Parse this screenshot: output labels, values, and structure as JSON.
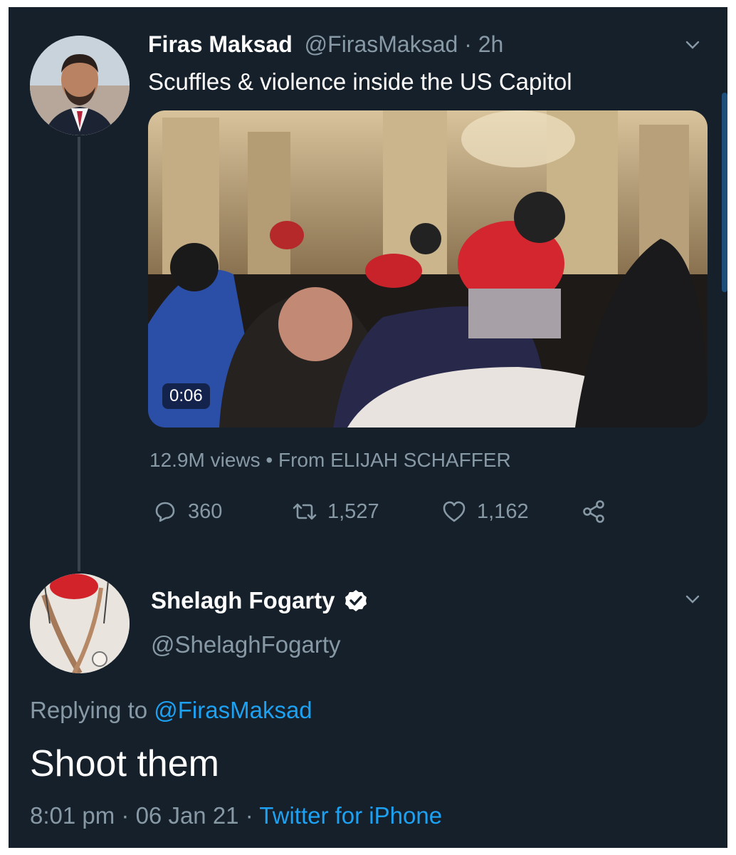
{
  "colors": {
    "background": "#15202b",
    "text_primary": "#ffffff",
    "text_secondary": "#8899a6",
    "link": "#1da1f2",
    "divider": "#38444d"
  },
  "tweet": {
    "author_name": "Firas Maksad",
    "author_handle": "@FirasMaksad",
    "separator": " · ",
    "time": "2h",
    "text": "Scuffles & violence inside the US Capitol",
    "video": {
      "duration": "0:06"
    },
    "views": "12.9M views",
    "views_separator": " • ",
    "source": "From ELIJAH SCHAFFER",
    "actions": {
      "replies": "360",
      "retweets": "1,527",
      "likes": "1,162",
      "reply_icon": "reply-icon",
      "retweet_icon": "retweet-icon",
      "like_icon": "heart-icon",
      "share_icon": "share-icon"
    }
  },
  "reply": {
    "author_name": "Shelagh Fogarty",
    "author_handle": "@ShelaghFogarty",
    "verified_icon": "verified-badge-icon",
    "replying_prefix": "Replying to ",
    "replying_to": "@FirasMaksad",
    "text": "Shoot them",
    "time": "8:01 pm",
    "date": "06 Jan 21",
    "separator": " · ",
    "client": "Twitter for iPhone"
  }
}
